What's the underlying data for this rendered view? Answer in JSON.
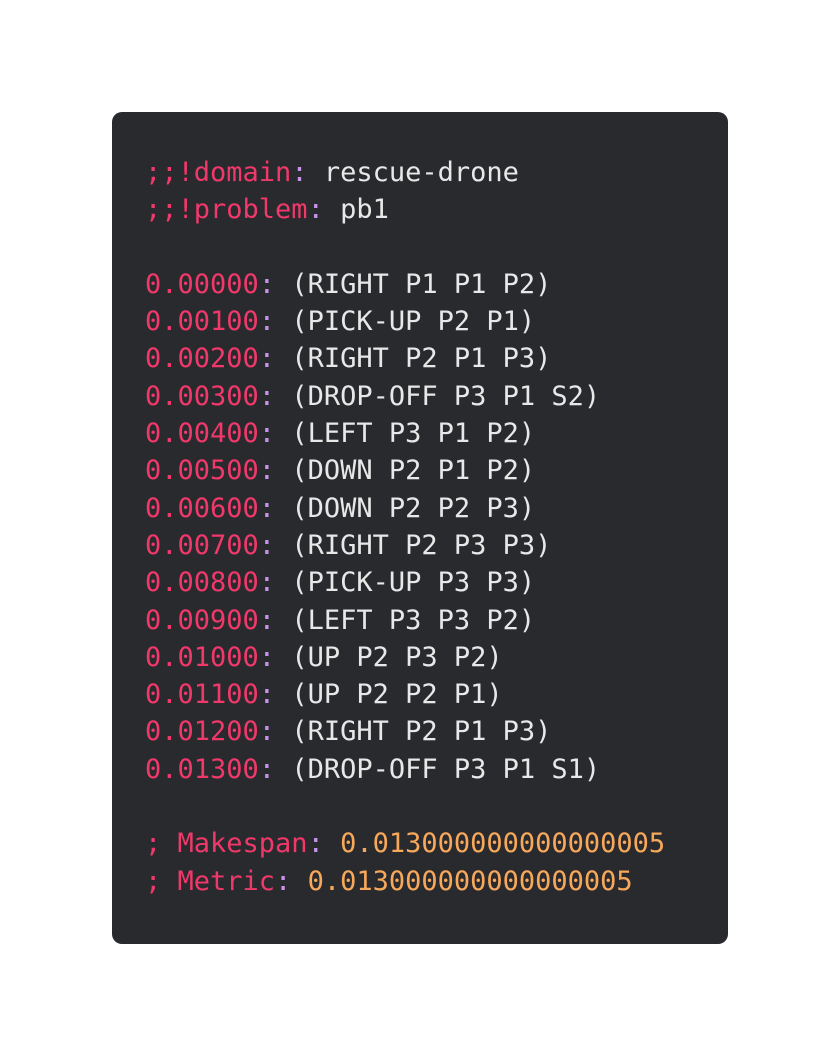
{
  "header": [
    {
      "key": ";;!domain",
      "value": "rescue-drone"
    },
    {
      "key": ";;!problem",
      "value": "pb1"
    }
  ],
  "plan": [
    {
      "time": "0.00000",
      "action": "(RIGHT P1 P1 P2)"
    },
    {
      "time": "0.00100",
      "action": "(PICK-UP P2 P1)"
    },
    {
      "time": "0.00200",
      "action": "(RIGHT P2 P1 P3)"
    },
    {
      "time": "0.00300",
      "action": "(DROP-OFF P3 P1 S2)"
    },
    {
      "time": "0.00400",
      "action": "(LEFT P3 P1 P2)"
    },
    {
      "time": "0.00500",
      "action": "(DOWN P2 P1 P2)"
    },
    {
      "time": "0.00600",
      "action": "(DOWN P2 P2 P3)"
    },
    {
      "time": "0.00700",
      "action": "(RIGHT P2 P3 P3)"
    },
    {
      "time": "0.00800",
      "action": "(PICK-UP P3 P3)"
    },
    {
      "time": "0.00900",
      "action": "(LEFT P3 P3 P2)"
    },
    {
      "time": "0.01000",
      "action": "(UP P2 P3 P2)"
    },
    {
      "time": "0.01100",
      "action": "(UP P2 P2 P1)"
    },
    {
      "time": "0.01200",
      "action": "(RIGHT P2 P1 P3)"
    },
    {
      "time": "0.01300",
      "action": "(DROP-OFF P3 P1 S1)"
    }
  ],
  "footer": [
    {
      "key": "; Makespan",
      "value": "0.013000000000000005"
    },
    {
      "key": "; Metric",
      "value": "0.013000000000000005"
    }
  ],
  "colors": {
    "background": "#292a2d",
    "keyword": "#f0386b",
    "punctuation": "#c792ea",
    "text": "#e8e8e8",
    "number": "#f7a85b"
  }
}
